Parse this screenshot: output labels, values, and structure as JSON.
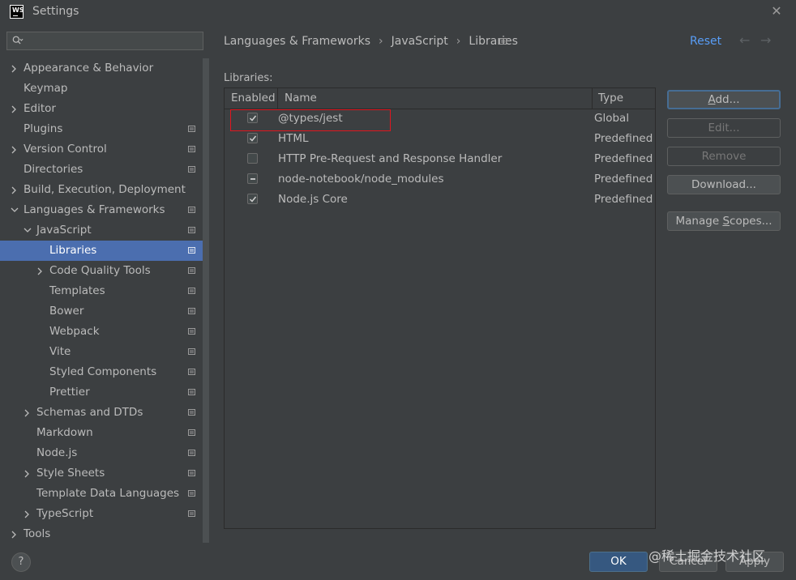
{
  "window": {
    "title": "Settings",
    "logo_text": "WS",
    "close_glyph": "✕"
  },
  "search": {
    "value": "",
    "placeholder": ""
  },
  "sidebar": {
    "items": [
      {
        "label": "Appearance & Behavior",
        "expandable": true,
        "expanded": false
      },
      {
        "label": "Keymap",
        "expandable": false
      },
      {
        "label": "Editor",
        "expandable": true,
        "expanded": false
      },
      {
        "label": "Plugins",
        "expandable": false,
        "project_icon": true
      },
      {
        "label": "Version Control",
        "expandable": true,
        "expanded": false,
        "project_icon": true
      },
      {
        "label": "Directories",
        "expandable": false,
        "project_icon": true
      },
      {
        "label": "Build, Execution, Deployment",
        "expandable": true,
        "expanded": false
      },
      {
        "label": "Languages & Frameworks",
        "expandable": true,
        "expanded": true,
        "project_icon": true
      },
      {
        "label": "JavaScript",
        "expandable": true,
        "expanded": true,
        "project_icon": true
      },
      {
        "label": "Libraries",
        "expandable": false,
        "selected": true,
        "project_icon": true
      },
      {
        "label": "Code Quality Tools",
        "expandable": true,
        "expanded": false,
        "project_icon": true
      },
      {
        "label": "Templates",
        "expandable": false,
        "project_icon": true
      },
      {
        "label": "Bower",
        "expandable": false,
        "project_icon": true
      },
      {
        "label": "Webpack",
        "expandable": false,
        "project_icon": true
      },
      {
        "label": "Vite",
        "expandable": false,
        "project_icon": true
      },
      {
        "label": "Styled Components",
        "expandable": false,
        "project_icon": true
      },
      {
        "label": "Prettier",
        "expandable": false,
        "project_icon": true
      },
      {
        "label": "Schemas and DTDs",
        "expandable": true,
        "expanded": false,
        "project_icon": true
      },
      {
        "label": "Markdown",
        "expandable": false,
        "project_icon": true
      },
      {
        "label": "Node.js",
        "expandable": false,
        "project_icon": true
      },
      {
        "label": "Style Sheets",
        "expandable": true,
        "expanded": false,
        "project_icon": true
      },
      {
        "label": "Template Data Languages",
        "expandable": false,
        "project_icon": true
      },
      {
        "label": "TypeScript",
        "expandable": true,
        "expanded": false,
        "project_icon": true
      },
      {
        "label": "Tools",
        "expandable": true,
        "expanded": false
      }
    ]
  },
  "breadcrumb": [
    "Languages & Frameworks",
    "JavaScript",
    "Libraries"
  ],
  "header": {
    "reset_label": "Reset",
    "back_glyph": "←",
    "forward_glyph": "→"
  },
  "libraries": {
    "label": "Libraries:",
    "columns": {
      "enabled": "Enabled",
      "name": "Name",
      "type": "Type"
    },
    "rows": [
      {
        "enabled": "checked",
        "name": "@types/jest",
        "type": "Global"
      },
      {
        "enabled": "checked",
        "name": "HTML",
        "type": "Predefined"
      },
      {
        "enabled": "unchecked",
        "name": "HTTP Pre-Request and Response Handler",
        "type": "Predefined"
      },
      {
        "enabled": "partial",
        "name": "node-notebook/node_modules",
        "type": "Predefined"
      },
      {
        "enabled": "checked",
        "name": "Node.js Core",
        "type": "Predefined"
      }
    ]
  },
  "buttons": {
    "add": {
      "mnemonic": "A",
      "rest": "dd..."
    },
    "edit": "Edit...",
    "remove": "Remove",
    "download": "Download...",
    "manage_scopes": {
      "before": "Manage ",
      "mnemonic": "S",
      "rest": "copes..."
    }
  },
  "footer": {
    "help": "?",
    "ok": "OK",
    "cancel": "Cancel",
    "apply": "Apply"
  },
  "watermark": "@稀土掘金技术社区",
  "colors": {
    "background": "#3c3f41",
    "selection": "#4b6eaf",
    "link": "#589df6",
    "ok_button": "#365880",
    "highlight_box": "#e0161f"
  }
}
